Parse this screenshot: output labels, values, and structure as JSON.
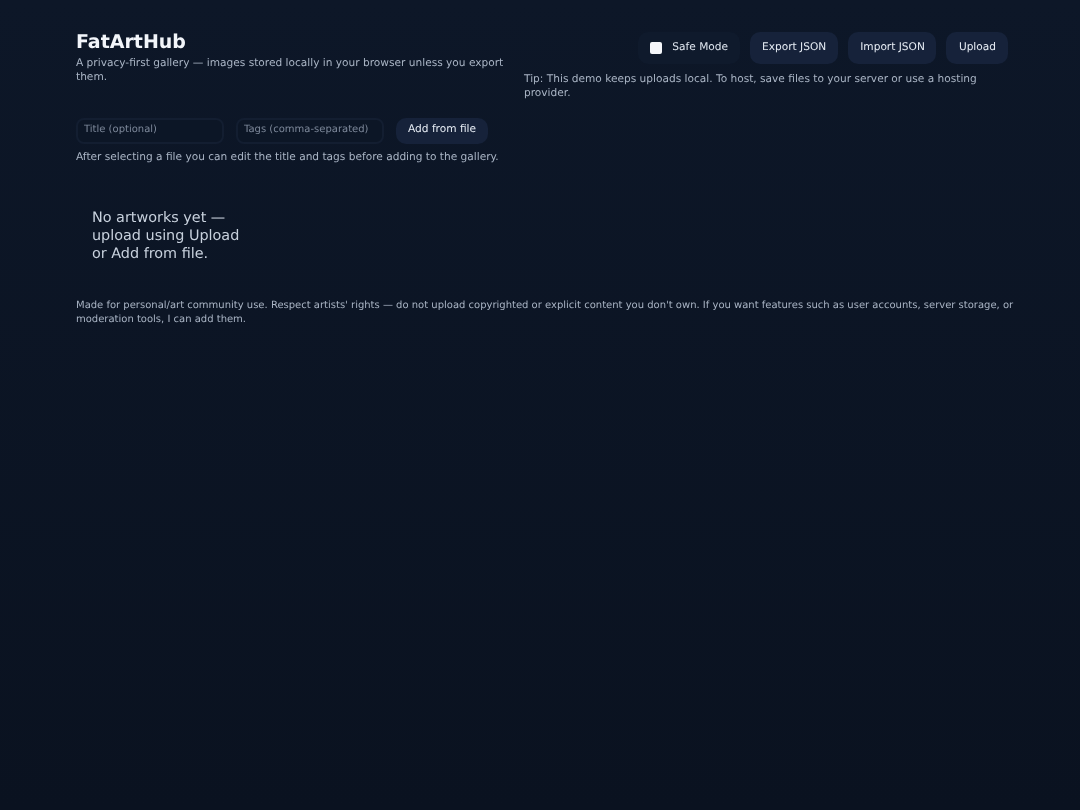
{
  "header": {
    "title": "FatArtHub",
    "subtitle": "A privacy-first gallery — images stored locally in your browser unless you export them."
  },
  "toolbar": {
    "safe_mode": {
      "label": "Safe Mode",
      "checked": false
    },
    "buttons": [
      "Export JSON",
      "Import JSON",
      "Upload"
    ]
  },
  "tip": "Tip: This demo keeps uploads local. To host, save files to your server or use a hosting provider.",
  "form": {
    "title_field": {
      "placeholder": "Title (optional)"
    },
    "tags_field": {
      "placeholder": "Tags (comma-separated)"
    },
    "add_button": "Add from file"
  },
  "helper": "After selecting a file you can edit the title and tags before adding to the gallery.",
  "empty_state": "No artworks yet — upload using Upload or Add from file.",
  "footer": "Made for personal/art community use. Respect artists' rights — do not upload copyrighted or explicit content you don't own. If you want features such as user accounts, server storage, or moderation tools, I can add them."
}
